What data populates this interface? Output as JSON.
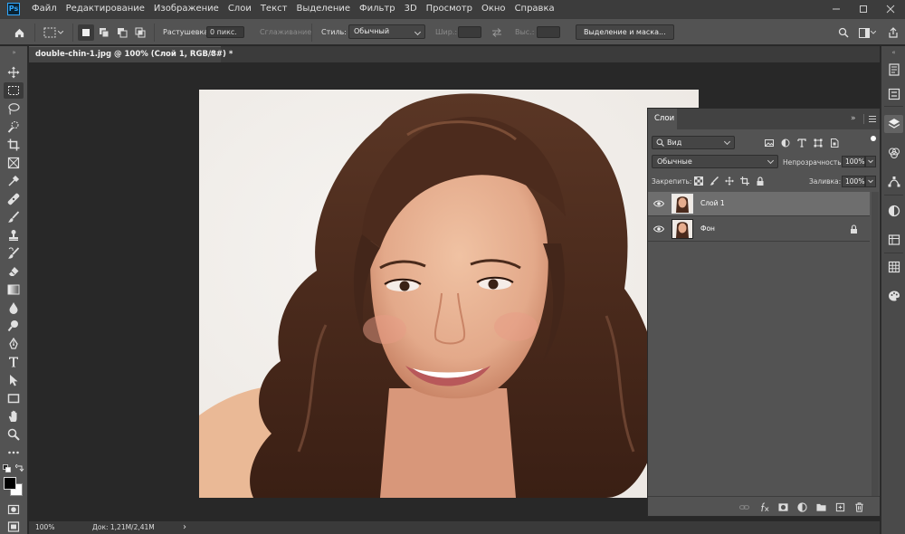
{
  "app": {
    "logo_text": "Ps"
  },
  "menu": [
    "Файл",
    "Редактирование",
    "Изображение",
    "Слои",
    "Текст",
    "Выделение",
    "Фильтр",
    "3D",
    "Просмотр",
    "Окно",
    "Справка"
  ],
  "options_bar": {
    "feather_label": "Растушевка:",
    "feather_value": "0 пикс.",
    "antialias_label": "Сглаживание",
    "style_label": "Стиль:",
    "style_value": "Обычный",
    "width_label": "Шир.:",
    "height_label": "Выс.:",
    "select_mask_label": "Выделение и маска..."
  },
  "document_tab": {
    "title": "double-chin-1.jpg @ 100% (Слой 1, RGB/8#) *",
    "close": "×"
  },
  "status_bar": {
    "zoom": "100%",
    "doc_info": "Док: 1,21M/2,41M",
    "arrow": "›"
  },
  "layers_panel": {
    "tab_label": "Слои",
    "filter_kind": "Вид",
    "blend_mode": "Обычные",
    "opacity_label": "Непрозрачность:",
    "opacity_value": "100%",
    "lock_label": "Закрепить:",
    "fill_label": "Заливка:",
    "fill_value": "100%",
    "layers": [
      {
        "name": "Слой 1",
        "selected": true,
        "visible": true,
        "locked": false
      },
      {
        "name": "Фон",
        "selected": false,
        "visible": true,
        "locked": true
      }
    ]
  },
  "colors": {
    "accent": "#31a8ff",
    "foreground": "#000000",
    "background": "#ffffff",
    "panel": "#535353",
    "workspace": "#282828",
    "selected_layer": "#6e6e6e"
  }
}
